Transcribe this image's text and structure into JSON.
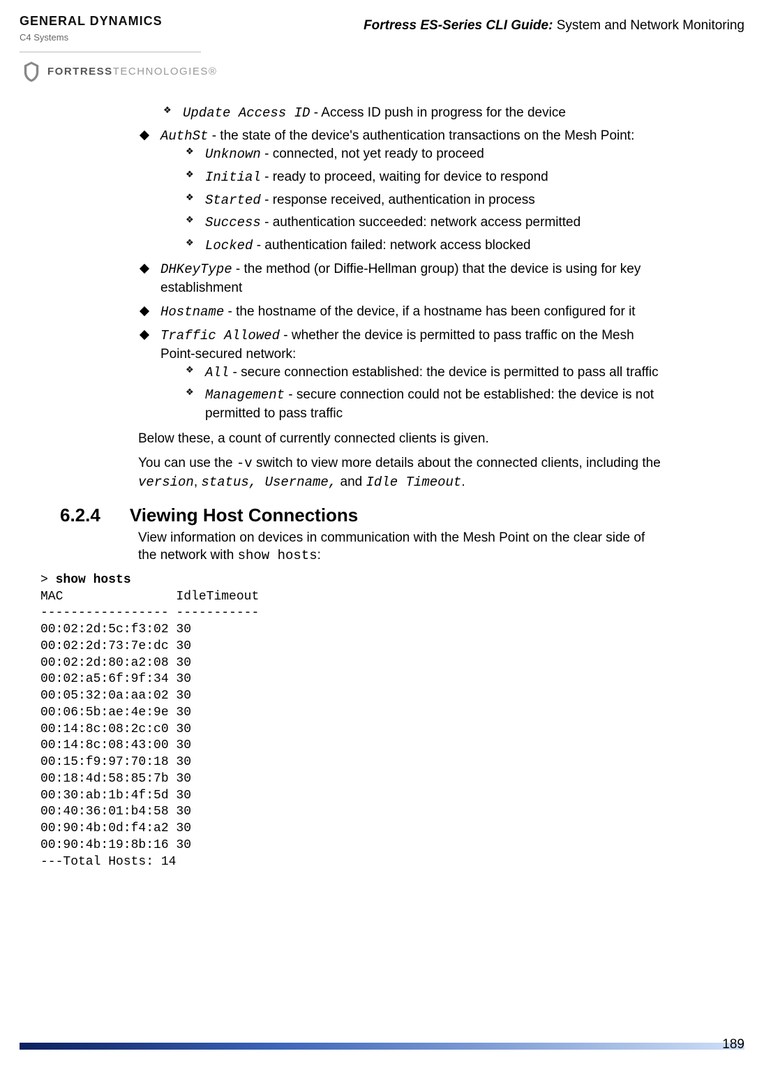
{
  "header": {
    "gd_logo": "GENERAL DYNAMICS",
    "gd_sub": "C4 Systems",
    "ft_logo_a": "FORTRESS",
    "ft_logo_b": "TECHNOLOGIES",
    "ft_logo_r": "®",
    "doc_title_prefix": "Fortress ES-Series CLI Guide:",
    "doc_title_rest": " System and Network Monitoring"
  },
  "items": {
    "top_update_id": "Update Access ID",
    "top_update_desc": " - Access ID push in progress for the device",
    "authst": "AuthSt",
    "authst_desc": " - the state of the device's authentication transactions on the Mesh Point:",
    "auth_unknown": "Unknown",
    "auth_unknown_desc": " - connected, not yet ready to proceed",
    "auth_initial": "Initial",
    "auth_initial_desc": " - ready to proceed, waiting for device to respond",
    "auth_started": "Started",
    "auth_started_desc": " - response received, authentication in process",
    "auth_success": "Success",
    "auth_success_desc": " - authentication succeeded: network access permitted",
    "auth_locked": "Locked",
    "auth_locked_desc": " - authentication failed: network access blocked",
    "dhkey": "DHKeyType",
    "dhkey_desc": " - the method (or Diffie-Hellman group) that the device is using for key establishment",
    "hostname": "Hostname",
    "hostname_desc": " - the hostname of the device, if a hostname has been configured for it",
    "traffic": "Traffic Allowed",
    "traffic_desc": " - whether the device is permitted to pass traffic on the Mesh Point-secured network:",
    "traffic_all": "All",
    "traffic_all_desc": " - secure connection established: the device is permitted to pass all traffic",
    "traffic_mgmt": "Management",
    "traffic_mgmt_desc": " - secure connection could not be established: the device is not permitted to pass traffic"
  },
  "paras": {
    "below": "Below these, a count of currently connected clients is given.",
    "you_can_a": "You can use the ",
    "you_can_sw": " -v",
    "you_can_b": " switch to view more details about the connected clients, including the ",
    "you_can_c": "version",
    "you_can_d": ", ",
    "you_can_e": "status, Username,",
    "you_can_f": " and ",
    "you_can_g": "Idle Timeout",
    "you_can_h": "."
  },
  "section": {
    "num": "6.2.4",
    "title": "Viewing Host Connections",
    "intro_a": "View information on devices in communication with the Mesh Point on the clear side of the network with ",
    "intro_cmd": "show hosts",
    "intro_b": ":"
  },
  "terminal": {
    "prompt": "> ",
    "cmd": "show hosts",
    "header": "MAC               IdleTimeout",
    "sep": "----------------- -----------",
    "rows": [
      "00:02:2d:5c:f3:02 30",
      "00:02:2d:73:7e:dc 30",
      "00:02:2d:80:a2:08 30",
      "00:02:a5:6f:9f:34 30",
      "00:05:32:0a:aa:02 30",
      "00:06:5b:ae:4e:9e 30",
      "00:14:8c:08:2c:c0 30",
      "00:14:8c:08:43:00 30",
      "00:15:f9:97:70:18 30",
      "00:18:4d:58:85:7b 30",
      "00:30:ab:1b:4f:5d 30",
      "00:40:36:01:b4:58 30",
      "00:90:4b:0d:f4:a2 30",
      "00:90:4b:19:8b:16 30"
    ],
    "total": "---Total Hosts: 14"
  },
  "footer": {
    "page": "189"
  }
}
